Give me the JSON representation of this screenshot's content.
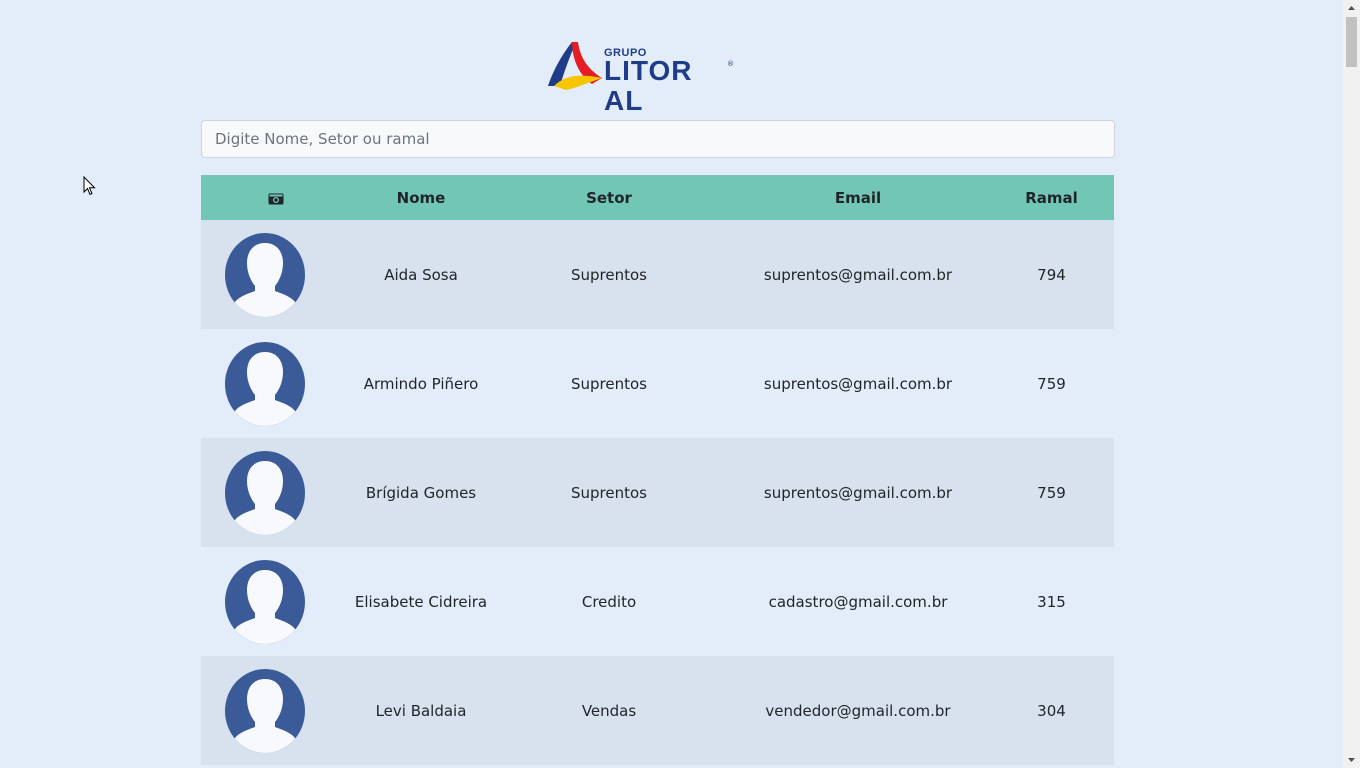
{
  "logo": {
    "small_text": "GRUPO",
    "big_text": "LITOR AL",
    "reg_mark": "®"
  },
  "search": {
    "placeholder": "Digite Nome, Setor ou ramal",
    "value": ""
  },
  "table": {
    "headers": {
      "photo_icon": "camera-icon",
      "name": "Nome",
      "sector": "Setor",
      "email": "Email",
      "extension": "Ramal"
    },
    "rows": [
      {
        "name": "Aida Sosa",
        "sector": "Suprentos",
        "email": "suprentos@gmail.com.br",
        "extension": "794"
      },
      {
        "name": "Armindo Piñero",
        "sector": "Suprentos",
        "email": "suprentos@gmail.com.br",
        "extension": "759"
      },
      {
        "name": "Brígida Gomes",
        "sector": "Suprentos",
        "email": "suprentos@gmail.com.br",
        "extension": "759"
      },
      {
        "name": "Elisabete Cidreira",
        "sector": "Credito",
        "email": "cadastro@gmail.com.br",
        "extension": "315"
      },
      {
        "name": "Levi Baldaia",
        "sector": "Vendas",
        "email": "vendedor@gmail.com.br",
        "extension": "304"
      }
    ]
  },
  "colors": {
    "background": "#e3edf9",
    "header": "#72c6b5",
    "row_alt": "#d8e2ef",
    "avatar": "#3b5b98",
    "brand_blue": "#1f3c88",
    "brand_red": "#e31e24",
    "brand_yellow": "#f7c600"
  }
}
